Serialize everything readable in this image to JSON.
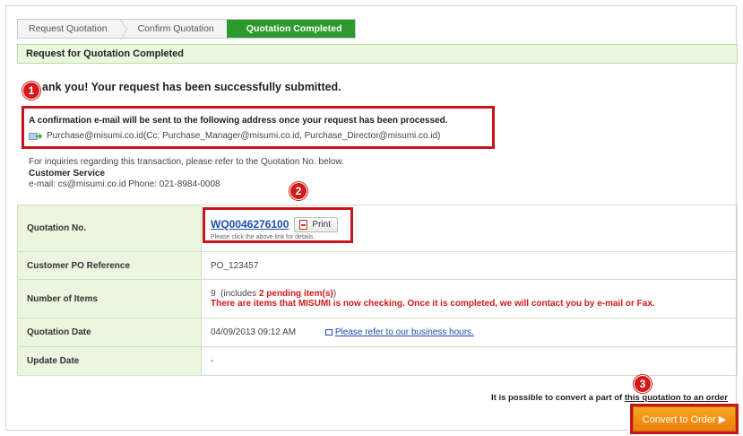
{
  "steps": [
    {
      "label": "Request Quotation"
    },
    {
      "label": "Confirm Quotation"
    },
    {
      "label": "Quotation Completed"
    }
  ],
  "page_heading": "Request for Quotation Completed",
  "thanks_text": "ank you! Your request has been successfully submitted.",
  "badges": {
    "one": "1",
    "two": "2",
    "three": "3"
  },
  "confirmation": {
    "message": "A confirmation e-mail will be sent to the following address once your request has been processed.",
    "addresses": "Purchase@misumi.co.id(Cc: Purchase_Manager@misumi.co.id, Purchase_Director@misumi.co.id)"
  },
  "inquiry": {
    "intro": "For inquiries regarding this transaction, please refer to the Quotation No. below.",
    "team": "Customer Service",
    "contact": "e-mail: cs@misumi.co.id   Phone: 021-8984-0008"
  },
  "table": {
    "quotation_no_label": "Quotation No.",
    "quotation_no": "WQ0046276100",
    "print_label": "Print",
    "print_hint": "Please click the above link for details.",
    "po_label": "Customer PO Reference",
    "po_value": "PO_123457",
    "items_label": "Number of Items",
    "items_count": "9",
    "items_includes": "(includes ",
    "items_pending": "2 pending item(s)",
    "items_close": ")",
    "items_warning": "There are items that MISUMI is now checking. Once it is completed, we will contact you by e-mail or Fax.",
    "date_label": "Quotation Date",
    "date_value": "04/09/2013 09:12 AM",
    "hours_link": "Please refer to our business hours.",
    "update_label": "Update Date",
    "update_value": "-"
  },
  "convert": {
    "note_pre": "It is possible to convert a part of ",
    "note_link": "this quotation to an order",
    "button": "Convert to Order ▶"
  },
  "colors": {
    "accent_green": "#2d9a2d",
    "header_bg": "#eaf6df",
    "highlight_red": "#c4161c",
    "button_orange": "#ec7d0a"
  }
}
